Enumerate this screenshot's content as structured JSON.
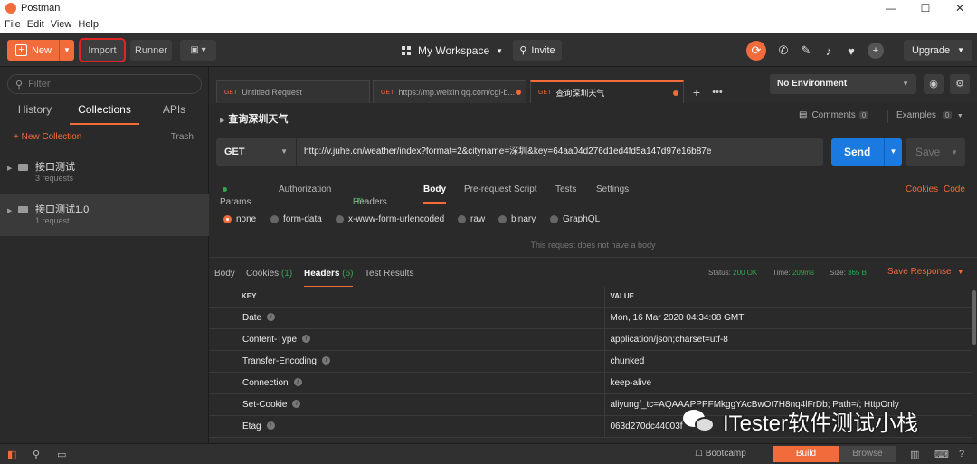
{
  "window": {
    "title": "Postman"
  },
  "menu": [
    "File",
    "Edit",
    "View",
    "Help"
  ],
  "header": {
    "new_label": "New",
    "import_label": "Import",
    "runner_label": "Runner",
    "workspace_label": "My Workspace",
    "invite_label": "Invite",
    "upgrade_label": "Upgrade"
  },
  "sidebar": {
    "filter_placeholder": "Filter",
    "tabs": [
      "History",
      "Collections",
      "APIs"
    ],
    "active_tab": "Collections",
    "new_collection": "+ New Collection",
    "trash": "Trash",
    "collections": [
      {
        "name": "接口测试",
        "count": "3 requests"
      },
      {
        "name": "接口测试1.0",
        "count": "1 request"
      }
    ]
  },
  "request_tabs": [
    {
      "method": "GET",
      "label": "Untitled Request"
    },
    {
      "method": "GET",
      "label": "https://mp.weixin.qq.com/cgi-b..."
    },
    {
      "method": "GET",
      "label": "查询深圳天气"
    }
  ],
  "environment": {
    "selected": "No Environment"
  },
  "request": {
    "name": "查询深圳天气",
    "comments_label": "Comments",
    "comments_count": "0",
    "examples_label": "Examples",
    "examples_count": "0",
    "method": "GET",
    "url": "http://v.juhe.cn/weather/index?format=2&cityname=深圳&key=64aa04d276d1ed4fd5a147d97e16b87e",
    "send_label": "Send",
    "save_label": "Save",
    "tabs": {
      "params": "Params",
      "authorization": "Authorization",
      "headers": "Headers",
      "headers_count": "(7)",
      "body": "Body",
      "prerequest": "Pre-request Script",
      "tests": "Tests",
      "settings": "Settings",
      "cookies": "Cookies",
      "code": "Code"
    },
    "body_types": [
      "none",
      "form-data",
      "x-www-form-urlencoded",
      "raw",
      "binary",
      "GraphQL"
    ],
    "selected_body_type": "none",
    "no_body_message": "This request does not have a body"
  },
  "response": {
    "tabs": {
      "body": "Body",
      "cookies": "Cookies",
      "cookies_count": "(1)",
      "headers": "Headers",
      "headers_count": "(6)",
      "test_results": "Test Results"
    },
    "status_label": "Status:",
    "status_value": "200 OK",
    "time_label": "Time:",
    "time_value": "209ms",
    "size_label": "Size:",
    "size_value": "365 B",
    "save_response": "Save Response",
    "columns": [
      "KEY",
      "VALUE"
    ],
    "headers": [
      {
        "key": "Date",
        "value": "Mon, 16 Mar 2020 04:34:08 GMT"
      },
      {
        "key": "Content-Type",
        "value": "application/json;charset=utf-8"
      },
      {
        "key": "Transfer-Encoding",
        "value": "chunked"
      },
      {
        "key": "Connection",
        "value": "keep-alive"
      },
      {
        "key": "Set-Cookie",
        "value": "aliyungf_tc=AQAAAPPPFMkggYAcBwOt7H8nq4lFrDb; Path=/; HttpOnly"
      },
      {
        "key": "Etag",
        "value": "063d270dc44003f"
      }
    ]
  },
  "watermark": {
    "text": "ITester软件测试小栈"
  },
  "footer": {
    "bootcamp": "Bootcamp",
    "build": "Build",
    "browse": "Browse"
  },
  "colors": {
    "accent": "#f26b3a",
    "send": "#1a7ae0",
    "success": "#2fa84f",
    "highlight": "#e02424"
  }
}
